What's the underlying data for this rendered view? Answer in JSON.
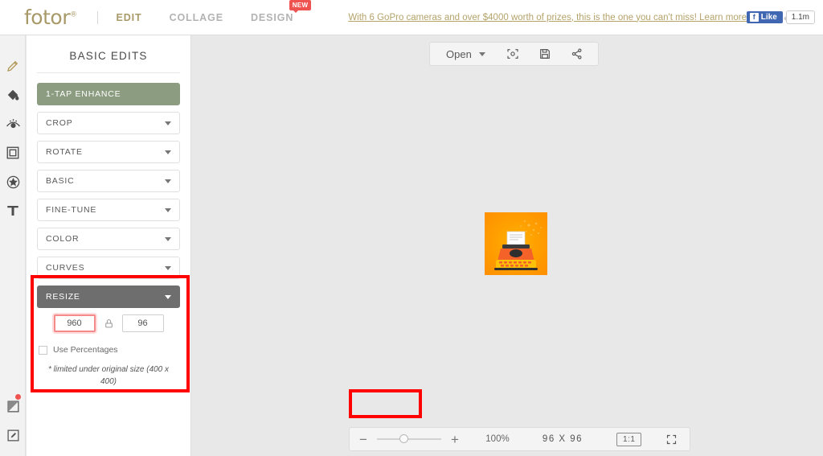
{
  "header": {
    "logo": "fotor",
    "logo_mark": "®",
    "nav": [
      {
        "label": "EDIT",
        "active": true,
        "badge": ""
      },
      {
        "label": "COLLAGE",
        "active": false,
        "badge": ""
      },
      {
        "label": "DESIGN",
        "active": false,
        "badge": "NEW"
      }
    ],
    "promo": "With 6 GoPro cameras and over $4000 worth of prizes, this is the one you can't miss! Learn more here ->",
    "facebook": {
      "like_label": "Like",
      "f_glyph": "f",
      "count": "1.1m"
    }
  },
  "rail": {
    "icons": [
      {
        "name": "pencil-icon",
        "active": true
      },
      {
        "name": "paint-bucket-icon",
        "active": false
      },
      {
        "name": "beauty-eye-icon",
        "active": false
      },
      {
        "name": "frame-icon",
        "active": false
      },
      {
        "name": "sticker-star-icon",
        "active": false
      },
      {
        "name": "text-tool-icon",
        "active": false
      }
    ],
    "bottom_icons": [
      {
        "name": "image-notification-icon",
        "has_dot": true
      },
      {
        "name": "edit-square-icon",
        "has_dot": false
      }
    ]
  },
  "sidebar": {
    "title": "BASIC EDITS",
    "enhance": "1-TAP ENHANCE",
    "tools": [
      {
        "label": "CROP"
      },
      {
        "label": "ROTATE"
      },
      {
        "label": "BASIC"
      },
      {
        "label": "FINE-TUNE"
      },
      {
        "label": "COLOR"
      },
      {
        "label": "CURVES"
      }
    ],
    "resize": {
      "header": "RESIZE",
      "width_value": "960",
      "height_value": "96",
      "lock_icon": "lock-icon",
      "percent_label": "Use Percentages",
      "percent_checked": false,
      "note": "* limited under original size (400 x 400)"
    }
  },
  "toolbar": {
    "open_label": "Open",
    "buttons": [
      {
        "name": "focus-icon"
      },
      {
        "name": "save-icon"
      },
      {
        "name": "share-icon"
      }
    ]
  },
  "bottom": {
    "minus": "−",
    "plus": "+",
    "zoom_percent": "100%",
    "slider_position_pct": 38,
    "dimensions": "96  X  96",
    "ratio_label": "1:1",
    "fullscreen_icon": "fullscreen-icon"
  },
  "annotations": {
    "color": "#ff0000",
    "regions": [
      "resize-panel",
      "canvas-dimensions"
    ]
  }
}
